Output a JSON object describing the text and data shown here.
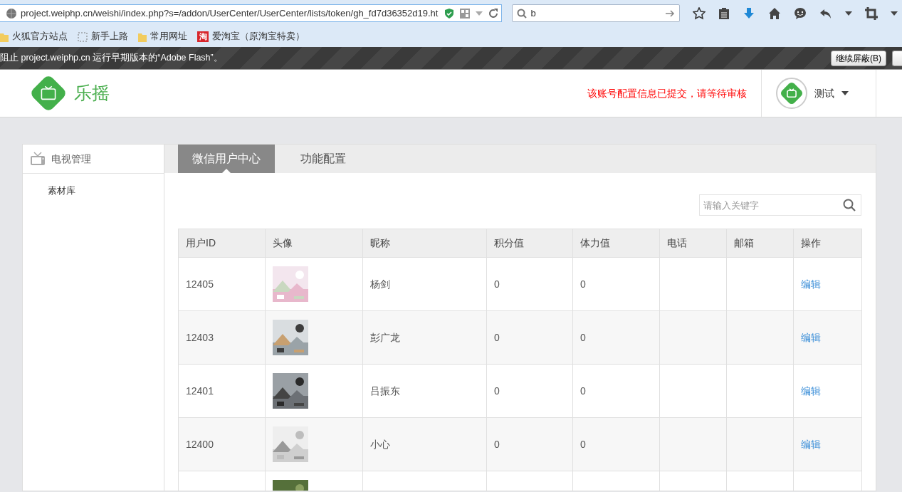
{
  "browser": {
    "address": "project.weiphp.cn/weishi/index.php?s=/addon/UserCenter/UserCenter/lists/token/gh_fd7d36352d19.ht",
    "search_value": "b",
    "bookmarks": [
      {
        "kind": "folder",
        "label": "火狐官方站点"
      },
      {
        "kind": "blank",
        "label": "新手上路"
      },
      {
        "kind": "folder",
        "label": "常用网址"
      },
      {
        "kind": "tag",
        "icon_text": "淘",
        "label": "爱淘宝（原淘宝特卖）"
      }
    ],
    "notification": {
      "text": "阻止 project.weiphp.cn 运行早期版本的“Adobe Flash”。",
      "button": "继续屏蔽(B)"
    }
  },
  "header": {
    "logo_text": "乐摇",
    "notice": "该账号配置信息已提交，请等待审核",
    "user": "测试"
  },
  "sidebar": {
    "section": "电视管理",
    "items": [
      {
        "label": "素材库"
      }
    ]
  },
  "tabs": [
    {
      "label": "微信用户中心",
      "selected": true
    },
    {
      "label": "功能配置",
      "selected": false
    }
  ],
  "search": {
    "placeholder": "请输入关键字"
  },
  "table": {
    "columns": [
      "用户ID",
      "头像",
      "昵称",
      "积分值",
      "体力值",
      "电话",
      "邮箱",
      "操作"
    ],
    "rows": [
      {
        "id": "12405",
        "avatar": {
          "kind": "picture"
        },
        "nickname": "杨剑",
        "points": "0",
        "stamina": "0",
        "action": "编辑"
      },
      {
        "id": "12403",
        "avatar": {
          "kind": "picture"
        },
        "nickname": "彭广龙",
        "points": "0",
        "stamina": "0",
        "action": "编辑"
      },
      {
        "id": "12401",
        "avatar": {
          "kind": "picture"
        },
        "nickname": "吕振东",
        "points": "0",
        "stamina": "0",
        "action": "编辑"
      },
      {
        "id": "12400",
        "avatar": {
          "kind": "picture"
        },
        "nickname": "小心",
        "points": "0",
        "stamina": "0",
        "action": "编辑"
      },
      {
        "avatar": {
          "kind": "picture"
        }
      }
    ]
  }
}
